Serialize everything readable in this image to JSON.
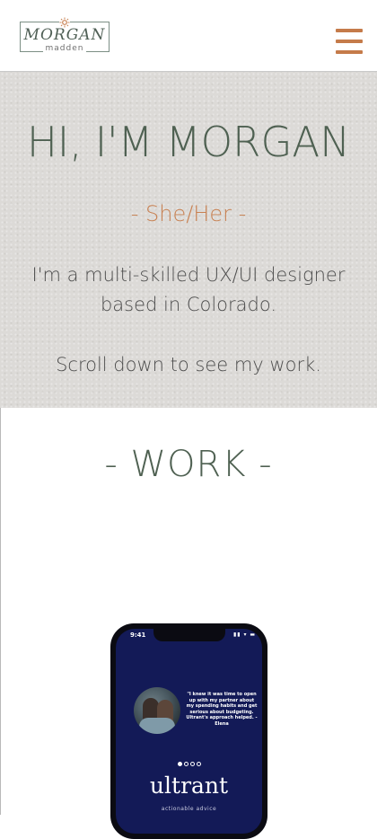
{
  "header": {
    "logo_main": "MORGAN",
    "logo_sub": "madden",
    "menu_icon": "hamburger-menu-icon",
    "accent_color": "#c57b4a"
  },
  "hero": {
    "title": "HI, I'M MORGAN",
    "pronouns": "- She/Her -",
    "bio": "I'm a multi-skilled UX/UI designer based in Colorado.",
    "scroll_cta": "Scroll down to see my work."
  },
  "work": {
    "heading": "- WORK -",
    "project": {
      "status_time": "9:41",
      "status_icons": "▮▮ ▾ ▬",
      "quote": "\"I knew it was time to open up with my partner about my spending habits and get serious about budgeting. Ultrant's approach helped. -Elena",
      "brand": "ultrant",
      "tagline": "actionable advice",
      "carousel_pages": 4,
      "carousel_active": 1,
      "screen_color": "#131a57"
    }
  }
}
